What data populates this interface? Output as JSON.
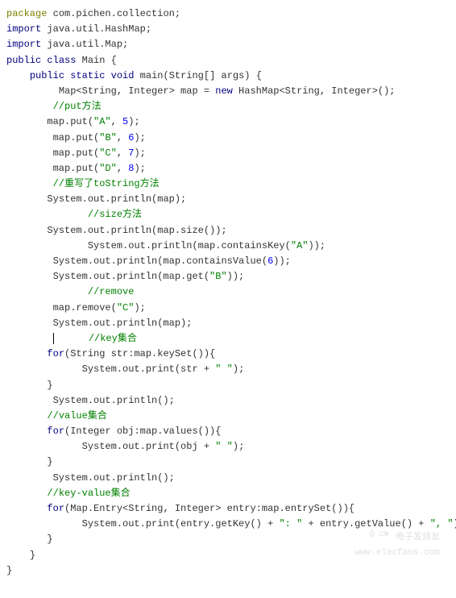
{
  "lines": [
    {
      "indent": 0,
      "tokens": [
        {
          "cls": "kw-package",
          "t": "package"
        },
        {
          "cls": "text",
          "t": " com.pichen.collection;"
        }
      ]
    },
    {
      "indent": 0,
      "tokens": [
        {
          "cls": "kw-import",
          "t": "import"
        },
        {
          "cls": "text",
          "t": " java.util.HashMap;"
        }
      ]
    },
    {
      "indent": 0,
      "tokens": [
        {
          "cls": "kw-import",
          "t": "import"
        },
        {
          "cls": "text",
          "t": " java.util.Map;"
        }
      ]
    },
    {
      "indent": 0,
      "tokens": [
        {
          "cls": "kw-public",
          "t": "public"
        },
        {
          "cls": "text",
          "t": " "
        },
        {
          "cls": "kw-class",
          "t": "class"
        },
        {
          "cls": "text",
          "t": " Main {"
        }
      ]
    },
    {
      "indent": 4,
      "tokens": [
        {
          "cls": "kw-public",
          "t": "public"
        },
        {
          "cls": "text",
          "t": " "
        },
        {
          "cls": "kw-static",
          "t": "static"
        },
        {
          "cls": "text",
          "t": " "
        },
        {
          "cls": "kw-void",
          "t": "void"
        },
        {
          "cls": "text",
          "t": " main(String[] args) {"
        }
      ]
    },
    {
      "indent": 9,
      "tokens": [
        {
          "cls": "text",
          "t": "Map<String, Integer> map = "
        },
        {
          "cls": "kw-new",
          "t": "new"
        },
        {
          "cls": "text",
          "t": " HashMap<String, Integer>();"
        }
      ]
    },
    {
      "indent": 8,
      "tokens": [
        {
          "cls": "comment",
          "t": "//put方法"
        }
      ]
    },
    {
      "indent": 7,
      "tokens": [
        {
          "cls": "text",
          "t": "map.put("
        },
        {
          "cls": "string",
          "t": "\"A\""
        },
        {
          "cls": "text",
          "t": ", "
        },
        {
          "cls": "number",
          "t": "5"
        },
        {
          "cls": "text",
          "t": ");"
        }
      ]
    },
    {
      "indent": 8,
      "tokens": [
        {
          "cls": "text",
          "t": "map.put("
        },
        {
          "cls": "string",
          "t": "\"B\""
        },
        {
          "cls": "text",
          "t": ", "
        },
        {
          "cls": "number",
          "t": "6"
        },
        {
          "cls": "text",
          "t": ");"
        }
      ]
    },
    {
      "indent": 8,
      "tokens": [
        {
          "cls": "text",
          "t": "map.put("
        },
        {
          "cls": "string",
          "t": "\"C\""
        },
        {
          "cls": "text",
          "t": ", "
        },
        {
          "cls": "number",
          "t": "7"
        },
        {
          "cls": "text",
          "t": ");"
        }
      ]
    },
    {
      "indent": 8,
      "tokens": [
        {
          "cls": "text",
          "t": "map.put("
        },
        {
          "cls": "string",
          "t": "\"D\""
        },
        {
          "cls": "text",
          "t": ", "
        },
        {
          "cls": "number",
          "t": "8"
        },
        {
          "cls": "text",
          "t": ");"
        }
      ]
    },
    {
      "indent": 0,
      "tokens": [
        {
          "cls": "text",
          "t": ""
        }
      ]
    },
    {
      "indent": 8,
      "tokens": [
        {
          "cls": "comment",
          "t": "//重写了toString方法"
        }
      ]
    },
    {
      "indent": 7,
      "tokens": [
        {
          "cls": "text",
          "t": "System.out.println(map);"
        }
      ]
    },
    {
      "indent": 14,
      "tokens": [
        {
          "cls": "comment",
          "t": "//size方法"
        }
      ]
    },
    {
      "indent": 7,
      "tokens": [
        {
          "cls": "text",
          "t": "System.out.println(map.size());"
        }
      ]
    },
    {
      "indent": 14,
      "tokens": [
        {
          "cls": "text",
          "t": "System.out.println(map.containsKey("
        },
        {
          "cls": "string",
          "t": "\"A\""
        },
        {
          "cls": "text",
          "t": "));"
        }
      ]
    },
    {
      "indent": 8,
      "tokens": [
        {
          "cls": "text",
          "t": "System.out.println(map.containsValue("
        },
        {
          "cls": "number",
          "t": "6"
        },
        {
          "cls": "text",
          "t": "));"
        }
      ]
    },
    {
      "indent": 8,
      "tokens": [
        {
          "cls": "text",
          "t": "System.out.println(map.get("
        },
        {
          "cls": "string",
          "t": "\"B\""
        },
        {
          "cls": "text",
          "t": "));"
        }
      ]
    },
    {
      "indent": 14,
      "tokens": [
        {
          "cls": "comment",
          "t": "//remove"
        }
      ]
    },
    {
      "indent": 8,
      "tokens": [
        {
          "cls": "text",
          "t": "map.remove("
        },
        {
          "cls": "string",
          "t": "\"C\""
        },
        {
          "cls": "text",
          "t": ");"
        }
      ]
    },
    {
      "indent": 8,
      "tokens": [
        {
          "cls": "text",
          "t": "System.out.println(map);"
        }
      ]
    },
    {
      "indent": 8,
      "tokens": [
        {
          "cls": "cursor",
          "t": ""
        },
        {
          "cls": "text",
          "t": "      "
        },
        {
          "cls": "comment",
          "t": "//key集合"
        }
      ]
    },
    {
      "indent": 7,
      "tokens": [
        {
          "cls": "kw-for",
          "t": "for"
        },
        {
          "cls": "text",
          "t": "(String str:map.keySet()){"
        }
      ]
    },
    {
      "indent": 13,
      "tokens": [
        {
          "cls": "text",
          "t": "System.out.print(str + "
        },
        {
          "cls": "string",
          "t": "\" \""
        },
        {
          "cls": "text",
          "t": ");"
        }
      ]
    },
    {
      "indent": 7,
      "tokens": [
        {
          "cls": "text",
          "t": "}"
        }
      ]
    },
    {
      "indent": 0,
      "tokens": [
        {
          "cls": "text",
          "t": ""
        }
      ]
    },
    {
      "indent": 8,
      "tokens": [
        {
          "cls": "text",
          "t": "System.out.println();"
        }
      ]
    },
    {
      "indent": 7,
      "tokens": [
        {
          "cls": "comment",
          "t": "//value集合"
        }
      ]
    },
    {
      "indent": 7,
      "tokens": [
        {
          "cls": "kw-for",
          "t": "for"
        },
        {
          "cls": "text",
          "t": "(Integer obj:map.values()){"
        }
      ]
    },
    {
      "indent": 13,
      "tokens": [
        {
          "cls": "text",
          "t": "System.out.print(obj + "
        },
        {
          "cls": "string",
          "t": "\" \""
        },
        {
          "cls": "text",
          "t": ");"
        }
      ]
    },
    {
      "indent": 7,
      "tokens": [
        {
          "cls": "text",
          "t": "}"
        }
      ]
    },
    {
      "indent": 0,
      "tokens": [
        {
          "cls": "text",
          "t": ""
        }
      ]
    },
    {
      "indent": 8,
      "tokens": [
        {
          "cls": "text",
          "t": "System.out.println();"
        }
      ]
    },
    {
      "indent": 7,
      "tokens": [
        {
          "cls": "comment",
          "t": "//key-value集合"
        }
      ]
    },
    {
      "indent": 7,
      "tokens": [
        {
          "cls": "kw-for",
          "t": "for"
        },
        {
          "cls": "text",
          "t": "(Map.Entry<String, Integer> entry:map.entrySet()){"
        }
      ]
    },
    {
      "indent": 13,
      "tokens": [
        {
          "cls": "text",
          "t": "System.out.print(entry.getKey() + "
        },
        {
          "cls": "string",
          "t": "\": \""
        },
        {
          "cls": "text",
          "t": " + entry.getValue() + "
        },
        {
          "cls": "string",
          "t": "\", \""
        },
        {
          "cls": "text",
          "t": ");"
        }
      ]
    },
    {
      "indent": 7,
      "tokens": [
        {
          "cls": "text",
          "t": "}"
        }
      ]
    },
    {
      "indent": 0,
      "tokens": [
        {
          "cls": "text",
          "t": ""
        }
      ]
    },
    {
      "indent": 4,
      "tokens": [
        {
          "cls": "text",
          "t": "}"
        }
      ]
    },
    {
      "indent": 0,
      "tokens": [
        {
          "cls": "text",
          "t": "}"
        }
      ]
    }
  ],
  "watermark": {
    "text": "电子发烧友",
    "url": "www.elecfans.com"
  }
}
